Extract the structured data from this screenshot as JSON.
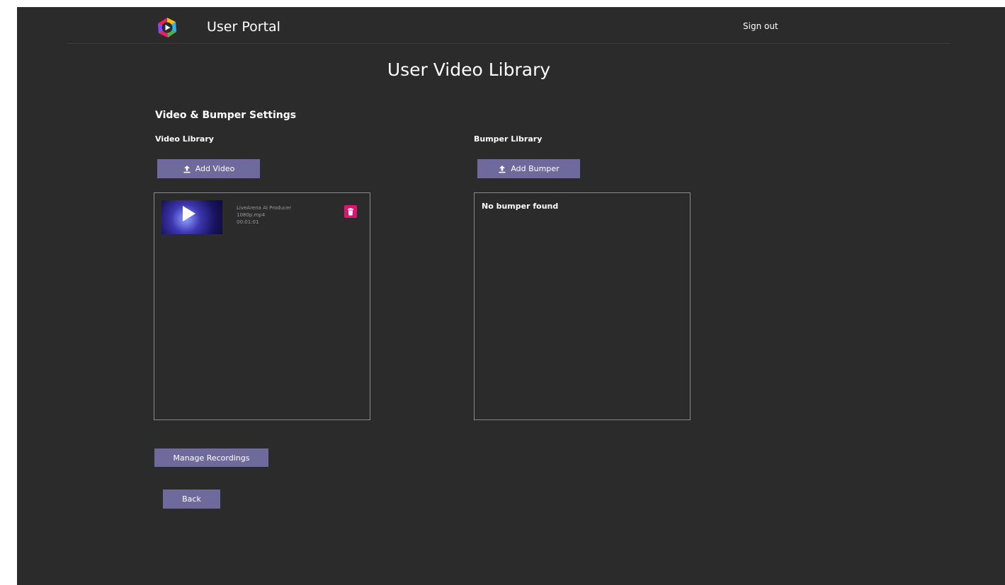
{
  "header": {
    "brand": "User Portal",
    "signout_label": "Sign out"
  },
  "page": {
    "title": "User Video Library",
    "section_title": "Video & Bumper Settings"
  },
  "video_library": {
    "label": "Video Library",
    "add_label": "Add Video",
    "videos": [
      {
        "title": "LiveArena AI Producer",
        "filename": "1080p.mp4",
        "duration": "00:01:01"
      }
    ]
  },
  "bumper_library": {
    "label": "Bumper Library",
    "add_label": "Add Bumper",
    "empty_message": "No bumper found"
  },
  "actions": {
    "manage_recordings_label": "Manage Recordings",
    "back_label": "Back"
  },
  "colors": {
    "background": "#2b2b2c",
    "button": "#6f6a9c",
    "delete": "#d8186e"
  },
  "icons": [
    "app-logo",
    "upload-icon",
    "play-icon",
    "trash-icon"
  ]
}
